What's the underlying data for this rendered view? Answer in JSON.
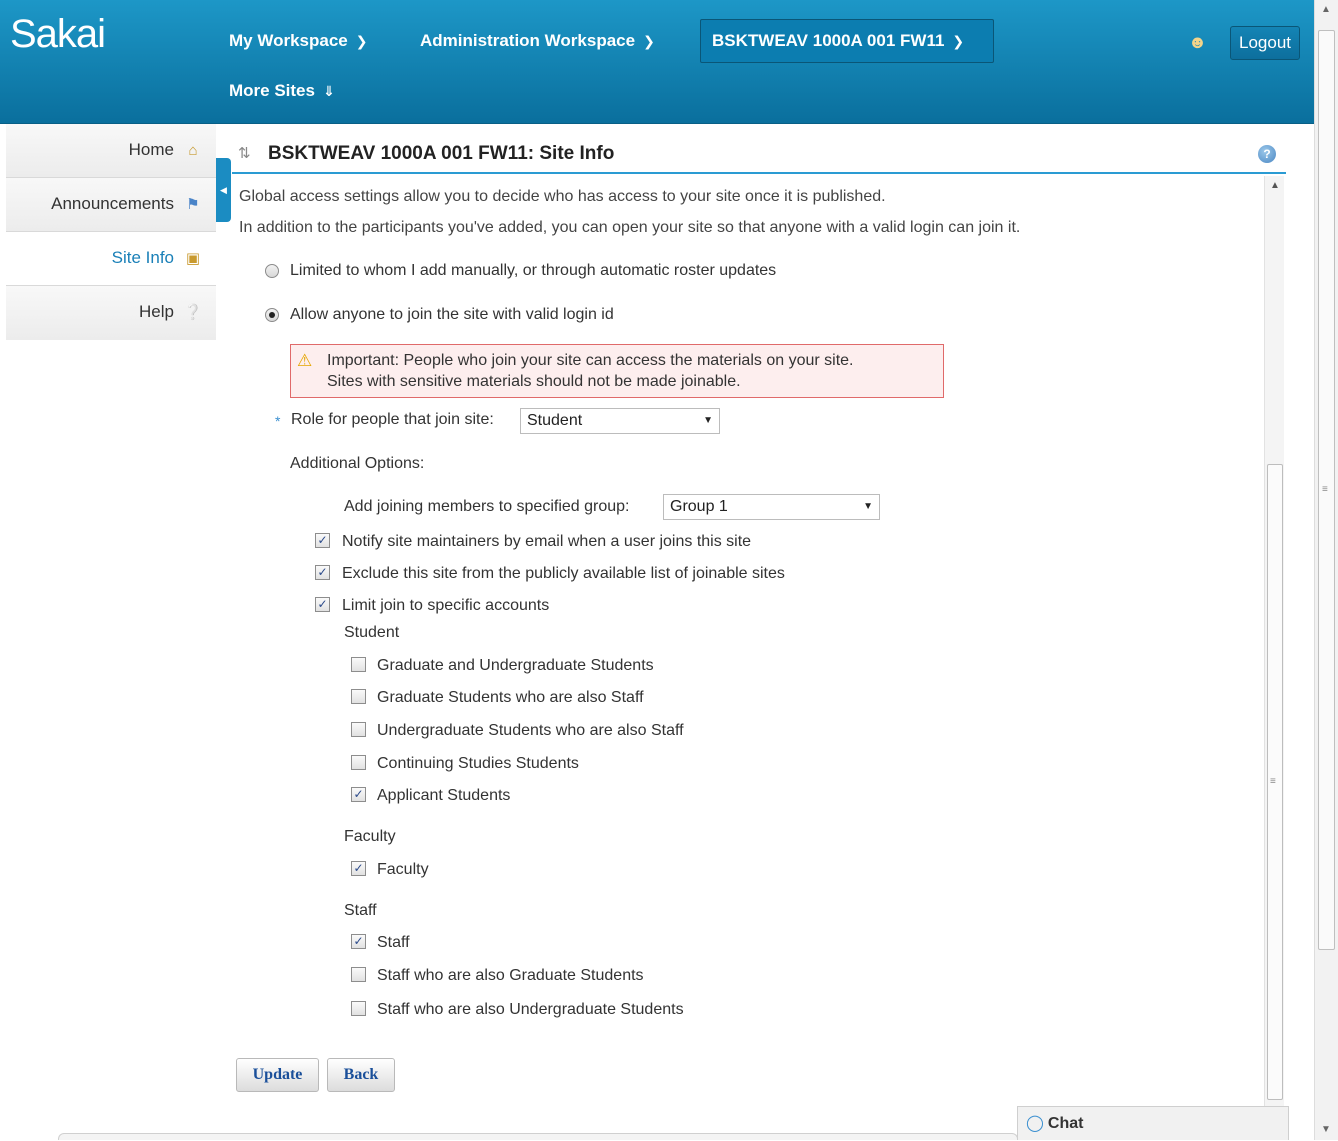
{
  "header": {
    "logo": "Sakai",
    "nav": {
      "my_workspace": "My Workspace",
      "admin_workspace": "Administration Workspace",
      "current_site": "BSKTWEAV 1000A 001 FW11",
      "more_sites": "More Sites"
    },
    "logout_label": "Logout"
  },
  "leftnav": {
    "items": [
      {
        "label": "Home"
      },
      {
        "label": "Announcements"
      },
      {
        "label": "Site Info"
      },
      {
        "label": "Help"
      }
    ]
  },
  "tool": {
    "title": "BSKTWEAV 1000A 001 FW11: Site Info",
    "intro1": "Global access settings allow you to decide who has access to your site once it is published.",
    "intro2": "In addition to the participants you've added, you can open your site so that anyone with a valid login can join it.",
    "radio_limited": "Limited to whom I add manually, or through automatic roster updates",
    "radio_anyone": "Allow anyone to join the site with valid login id",
    "warning_line1": "Important: People who join your site can access the materials on your site.",
    "warning_line2": "Sites with sensitive materials should not be made joinable.",
    "role_label": "Role for people that join site:",
    "role_value": "Student",
    "additional_options": "Additional Options:",
    "group_label": "Add joining members to specified group:",
    "group_value": "Group 1",
    "notify_label": "Notify site maintainers by email when a user joins this site",
    "exclude_label": "Exclude this site from the publicly available list of joinable sites",
    "limit_label": "Limit join to specific accounts",
    "student_heading": "Student",
    "student_options": [
      {
        "label": "Graduate and Undergraduate Students",
        "checked": false
      },
      {
        "label": "Graduate Students who are also Staff",
        "checked": false
      },
      {
        "label": "Undergraduate Students who are also Staff",
        "checked": false
      },
      {
        "label": "Continuing Studies Students",
        "checked": false
      },
      {
        "label": "Applicant Students",
        "checked": true
      }
    ],
    "faculty_heading": "Faculty",
    "faculty_options": [
      {
        "label": "Faculty",
        "checked": true
      }
    ],
    "staff_heading": "Staff",
    "staff_options": [
      {
        "label": "Staff",
        "checked": true
      },
      {
        "label": "Staff who are also Graduate Students",
        "checked": false
      },
      {
        "label": "Staff who are also Undergraduate Students",
        "checked": false
      }
    ],
    "update_label": "Update",
    "back_label": "Back"
  },
  "chat": {
    "label": "Chat"
  },
  "colors": {
    "header": "#0a84b8",
    "accent": "#2a9bd3",
    "warning_border": "#e06a6a"
  }
}
